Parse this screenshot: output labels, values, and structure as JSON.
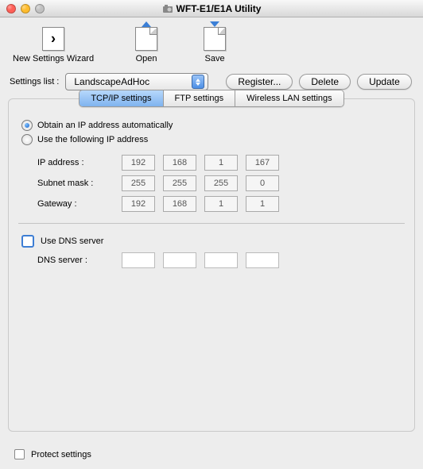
{
  "window": {
    "title": "WFT-E1/E1A Utility"
  },
  "toolbar": {
    "newWizard": "New Settings Wizard",
    "open": "Open",
    "save": "Save"
  },
  "settingsList": {
    "label": "Settings list :",
    "value": "LandscapeAdHoc",
    "register": "Register...",
    "delete": "Delete",
    "update": "Update"
  },
  "tabs": {
    "tcpip": "TCP/IP settings",
    "ftp": "FTP settings",
    "wlan": "Wireless LAN settings"
  },
  "tcpip": {
    "radioAuto": "Obtain an IP address automatically",
    "radioManual": "Use the following IP address",
    "labels": {
      "ip": "IP address :",
      "subnet": "Subnet mask :",
      "gateway": "Gateway :"
    },
    "ip": [
      "192",
      "168",
      "1",
      "167"
    ],
    "subnet": [
      "255",
      "255",
      "255",
      "0"
    ],
    "gateway": [
      "192",
      "168",
      "1",
      "1"
    ],
    "useDns": "Use DNS server",
    "dnsLabel": "DNS server :"
  },
  "footer": {
    "protect": "Protect settings"
  }
}
